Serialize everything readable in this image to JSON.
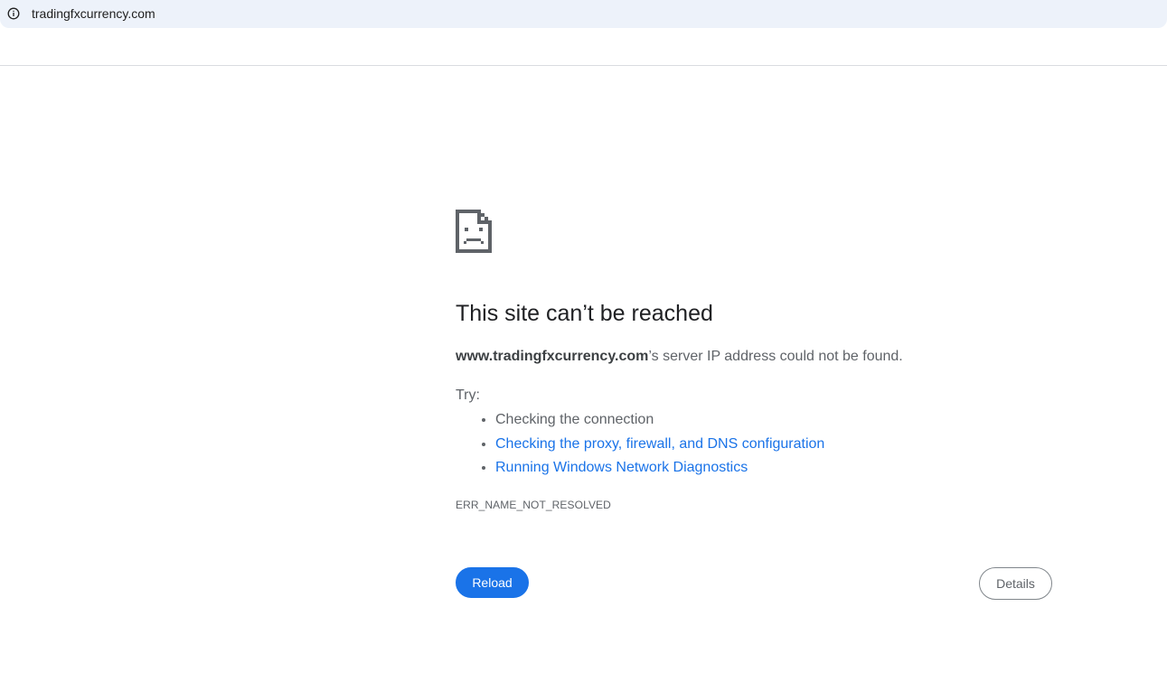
{
  "omnibox": {
    "url": "tradingfxcurrency.com",
    "icon": "info-icon"
  },
  "error_page": {
    "icon": "sad-document-icon",
    "title": "This site can’t be reached",
    "summary_host": "www.tradingfxcurrency.com",
    "summary_rest": "’s server IP address could not be found.",
    "try_label": "Try:",
    "suggestions": [
      {
        "label": "Checking the connection",
        "is_link": false
      },
      {
        "label": "Checking the proxy, firewall, and DNS configuration",
        "is_link": true
      },
      {
        "label": "Running Windows Network Diagnostics",
        "is_link": true
      }
    ],
    "error_code": "ERR_NAME_NOT_RESOLVED",
    "reload_label": "Reload",
    "details_label": "Details"
  },
  "colors": {
    "accent": "#1a73e8",
    "omnibox_bg": "#edf2fa",
    "text_secondary": "#5f6368"
  }
}
